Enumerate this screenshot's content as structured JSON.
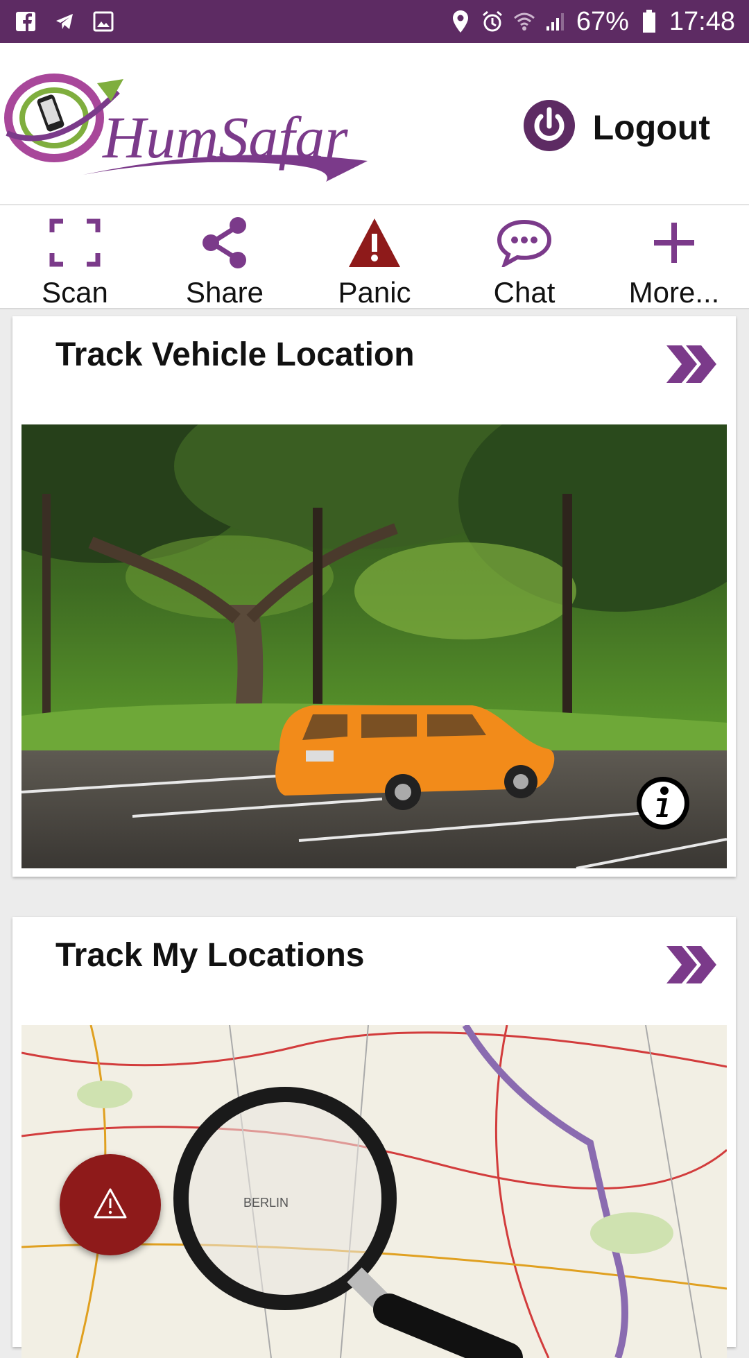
{
  "status_bar": {
    "battery": "67%",
    "time": "17:48",
    "icons_left": [
      "facebook-icon",
      "telegram-icon",
      "gallery-icon"
    ],
    "icons_right": [
      "location-icon",
      "alarm-icon",
      "wifi-icon",
      "signal-icon",
      "battery-icon"
    ]
  },
  "header": {
    "logo_text": "HumSafar",
    "logout_label": "Logout"
  },
  "toolbar": {
    "items": [
      {
        "label": "Scan",
        "icon": "scan-icon"
      },
      {
        "label": "Share",
        "icon": "share-icon"
      },
      {
        "label": "Panic",
        "icon": "warning-icon"
      },
      {
        "label": "Chat",
        "icon": "chat-icon"
      },
      {
        "label": "More...",
        "icon": "plus-icon"
      }
    ]
  },
  "cards": [
    {
      "title": "Track Vehicle Location",
      "image": "orange car parked under trees"
    },
    {
      "title": "Track My Locations",
      "image": "map with magnifying glass"
    }
  ],
  "fab": {
    "icon": "warning-icon"
  },
  "colors": {
    "brand_purple": "#5d2b63",
    "accent_purple": "#7b3a8a",
    "panic_red": "#8e1a1a",
    "logo_green": "#7fae3e"
  }
}
